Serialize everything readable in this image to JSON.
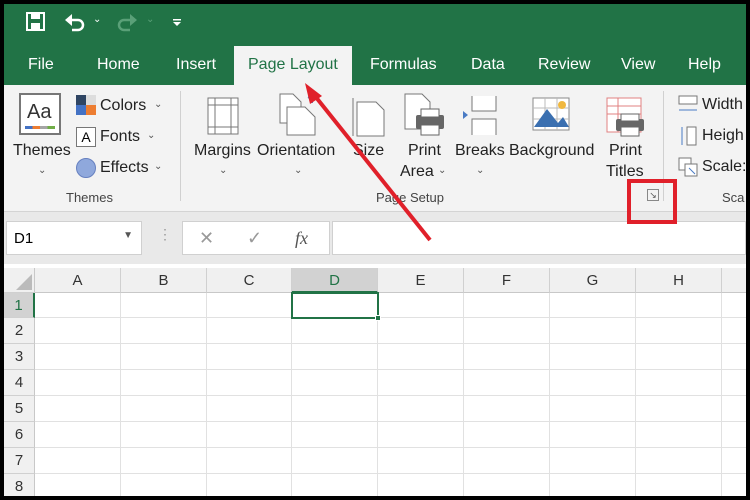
{
  "qat": {
    "icons": [
      "save-icon",
      "undo-icon",
      "redo-icon",
      "customize-qat-icon"
    ]
  },
  "tabs": [
    "File",
    "Home",
    "Insert",
    "Page Layout",
    "Formulas",
    "Data",
    "Review",
    "View",
    "Help"
  ],
  "active_tab": "Page Layout",
  "ribbon": {
    "themes_group": {
      "themes": "Themes",
      "colors": "Colors",
      "fonts": "Fonts",
      "effects": "Effects",
      "label": "Themes"
    },
    "page_setup": {
      "margins": "Margins",
      "orientation": "Orientation",
      "size": "Size",
      "print": "Print",
      "area": "Area",
      "breaks": "Breaks",
      "background": "Background",
      "print2": "Print",
      "titles": "Titles",
      "label": "Page Setup"
    },
    "scale_group": {
      "width": "Width",
      "height": "Heigh",
      "scale": "Scale:",
      "label": "Sca"
    }
  },
  "formula_bar": {
    "name_box": "D1",
    "cancel": "✕",
    "enter": "✓",
    "fx": "fx",
    "value": ""
  },
  "columns": [
    "A",
    "B",
    "C",
    "D",
    "E",
    "F",
    "G",
    "H"
  ],
  "rows": [
    "1",
    "2",
    "3",
    "4",
    "5",
    "6",
    "7",
    "8"
  ],
  "selected_cell": "D1",
  "annotation_colors": {
    "arrow": "#e0202a",
    "highlight_box": "#e0202a"
  },
  "accent": "#217346"
}
